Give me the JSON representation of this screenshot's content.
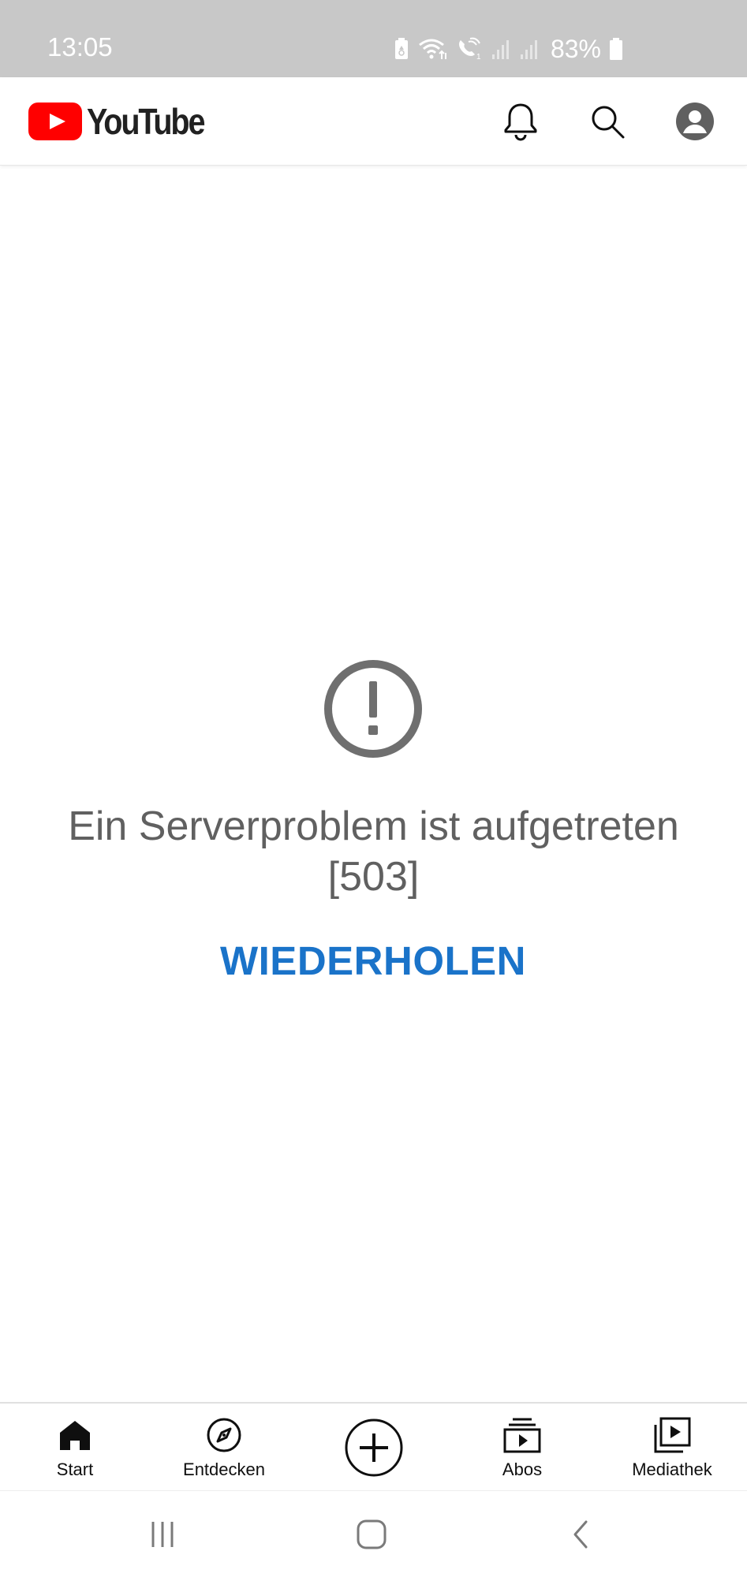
{
  "status_bar": {
    "time": "13:05",
    "battery_percent": "83%",
    "icons": [
      "battery-saver-icon",
      "wifi-icon",
      "wifi-calling-icon",
      "signal-icon",
      "signal-icon",
      "battery-icon"
    ]
  },
  "header": {
    "app_name": "YouTube",
    "icons": [
      "notifications-bell-icon",
      "search-icon",
      "account-icon"
    ]
  },
  "error": {
    "icon": "alert-circle-icon",
    "message": "Ein Serverproblem ist aufgetreten [503]",
    "retry_label": "WIEDERHOLEN"
  },
  "bottom_nav": {
    "items": [
      {
        "label": "Start",
        "icon": "home-icon",
        "active": true
      },
      {
        "label": "Entdecken",
        "icon": "compass-icon",
        "active": false
      },
      {
        "label": "",
        "icon": "create-plus-icon",
        "active": false
      },
      {
        "label": "Abos",
        "icon": "subscriptions-icon",
        "active": false
      },
      {
        "label": "Mediathek",
        "icon": "library-icon",
        "active": false
      }
    ]
  },
  "system_nav": {
    "icons": [
      "recents-icon",
      "home-circle-icon",
      "back-icon"
    ]
  },
  "colors": {
    "status_bar_bg": "#c8c8c8",
    "youtube_red": "#ff0000",
    "retry_blue": "#1a73c9",
    "error_text": "#606060",
    "error_icon": "#6f6f6f"
  }
}
